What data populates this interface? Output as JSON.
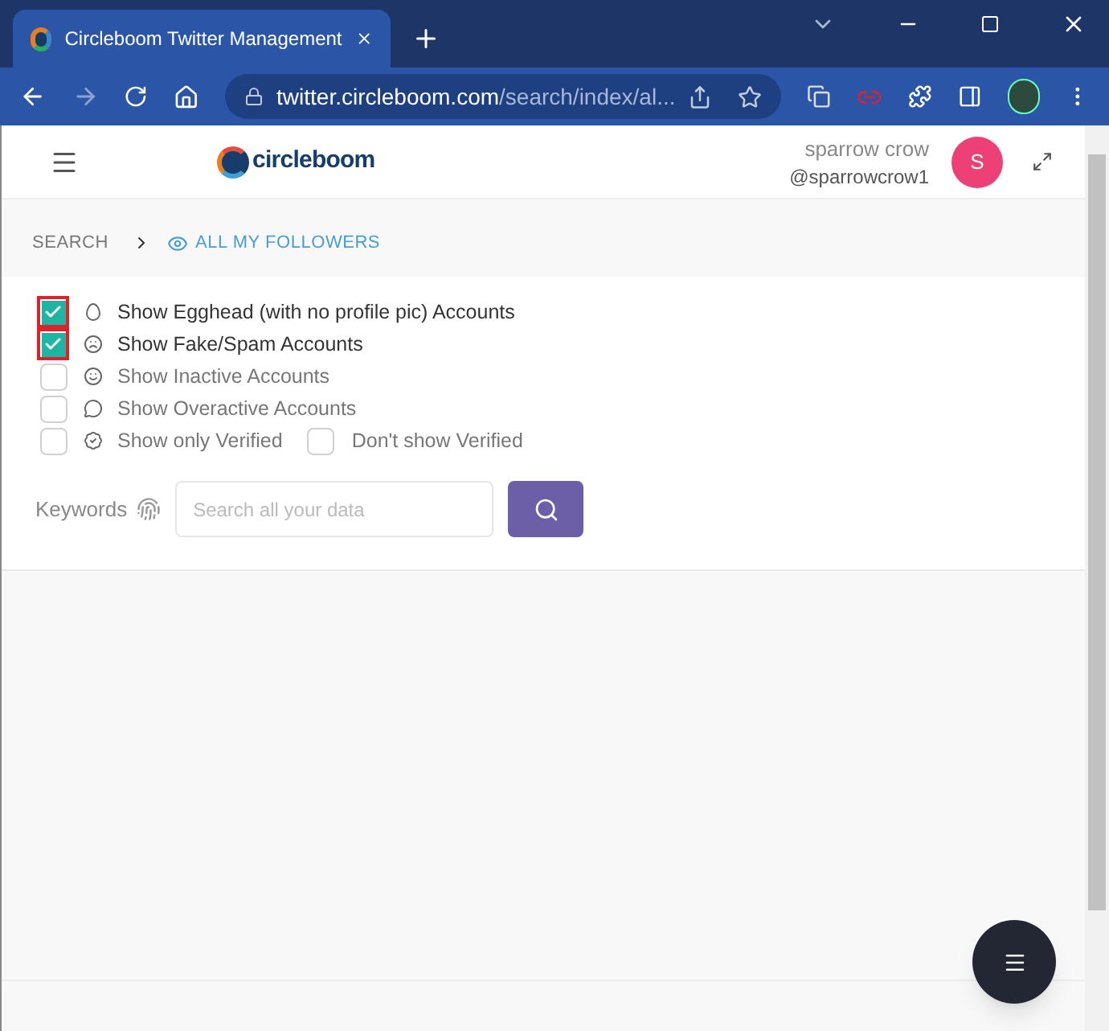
{
  "browser": {
    "tab_title": "Circleboom Twitter Management",
    "url_host": "twitter.circleboom.com",
    "url_path": "/search/index/al..."
  },
  "header": {
    "logo_text": "circleboom",
    "user_name": "sparrow crow",
    "user_handle": "@sparrowcrow1",
    "avatar_letter": "S"
  },
  "breadcrumb": {
    "root": "SEARCH",
    "current": "ALL MY FOLLOWERS"
  },
  "filters": [
    {
      "kind": "egghead",
      "label": "Show Egghead (with no profile pic) Accounts",
      "checked": true
    },
    {
      "kind": "fake",
      "label": "Show Fake/Spam Accounts",
      "checked": true
    },
    {
      "kind": "inactive",
      "label": "Show Inactive Accounts",
      "checked": false
    },
    {
      "kind": "overactive",
      "label": "Show Overactive Accounts",
      "checked": false
    }
  ],
  "verified": [
    {
      "kind": "verified",
      "label": "Show only Verified",
      "checked": false
    },
    {
      "kind": "plain",
      "label": "Don't show Verified",
      "checked": false
    }
  ],
  "keywords": {
    "label": "Keywords",
    "placeholder": "Search all your data"
  }
}
